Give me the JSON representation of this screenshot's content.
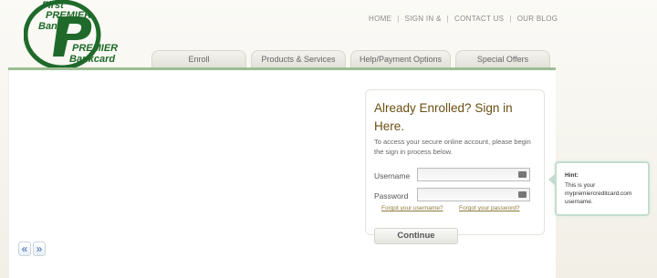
{
  "logo": {
    "line1": "First",
    "line2": "PREMIER",
    "line3": "Bank",
    "line4": "PREMIER",
    "line5": "Bankcard",
    "brand_color": "#1f6a2b"
  },
  "topnav": {
    "items": [
      "HOME",
      "SIGN IN &",
      "CONTACT US",
      "OUR BLOG"
    ],
    "separator": "|"
  },
  "tabs": [
    "Enroll",
    "Products & Services",
    "Help/Payment Options",
    "Special Offers"
  ],
  "carousel": {
    "prev_label": "«",
    "next_label": "»"
  },
  "signin": {
    "title": "Already Enrolled? Sign in Here.",
    "description": "To access your secure online account, please begin the sign in process below.",
    "username_label": "Username",
    "username_value": "",
    "password_label": "Password",
    "password_value": "",
    "forgot_username": "Forgot your username?",
    "forgot_password": "Forgot your password?",
    "continue_label": "Continue"
  },
  "hint": {
    "title": "Hint:",
    "body": "This is your mypremiercreditcard.com username."
  },
  "colors": {
    "accent_green": "#9ebd93",
    "title_brown": "#6b4f12",
    "link_color": "#8c7b3a"
  }
}
